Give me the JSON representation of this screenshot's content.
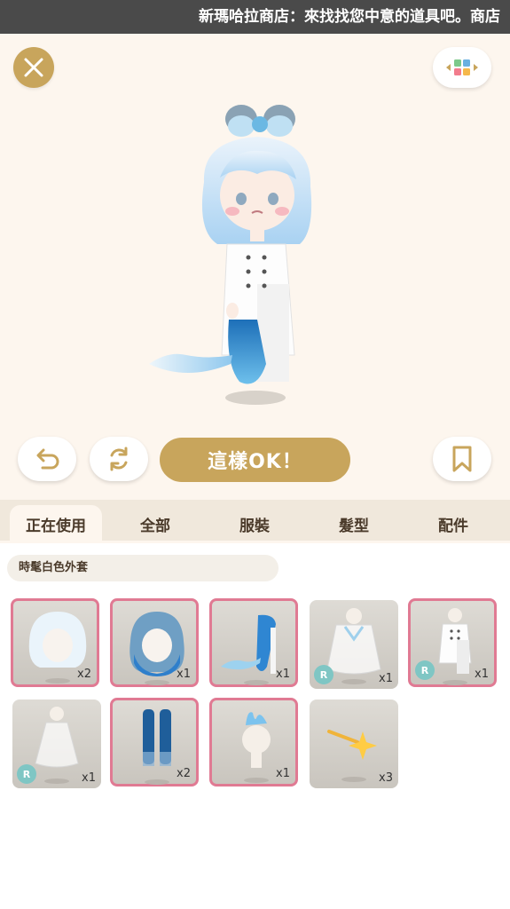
{
  "marquee": {
    "text": "新瑪哈拉商店：來找找您中意的道具吧。商店"
  },
  "stage": {
    "confirm_label": "這樣OK！"
  },
  "tabs": [
    {
      "label": "正在使用"
    },
    {
      "label": "全部"
    },
    {
      "label": "服裝"
    },
    {
      "label": "髮型"
    },
    {
      "label": "配件"
    }
  ],
  "selected_item_name": "時髦白色外套",
  "items": [
    {
      "count": "x2",
      "badge": "",
      "selected": true
    },
    {
      "count": "x1",
      "badge": "",
      "selected": true
    },
    {
      "count": "x1",
      "badge": "",
      "selected": true
    },
    {
      "count": "x1",
      "badge": "R",
      "selected": false
    },
    {
      "count": "x1",
      "badge": "R",
      "selected": true
    },
    {
      "count": "x1",
      "badge": "R",
      "selected": false
    },
    {
      "count": "x2",
      "badge": "",
      "selected": true
    },
    {
      "count": "x1",
      "badge": "",
      "selected": true
    },
    {
      "count": "x3",
      "badge": "",
      "selected": false
    }
  ],
  "icons": {
    "close": "close-icon",
    "grid": "grid-icon",
    "undo": "undo-icon",
    "refresh": "refresh-icon",
    "bookmark": "bookmark-icon"
  },
  "colors": {
    "accent_gold": "#c8a55c",
    "selected_border": "#e07a93",
    "badge": "#7fc6c4"
  }
}
